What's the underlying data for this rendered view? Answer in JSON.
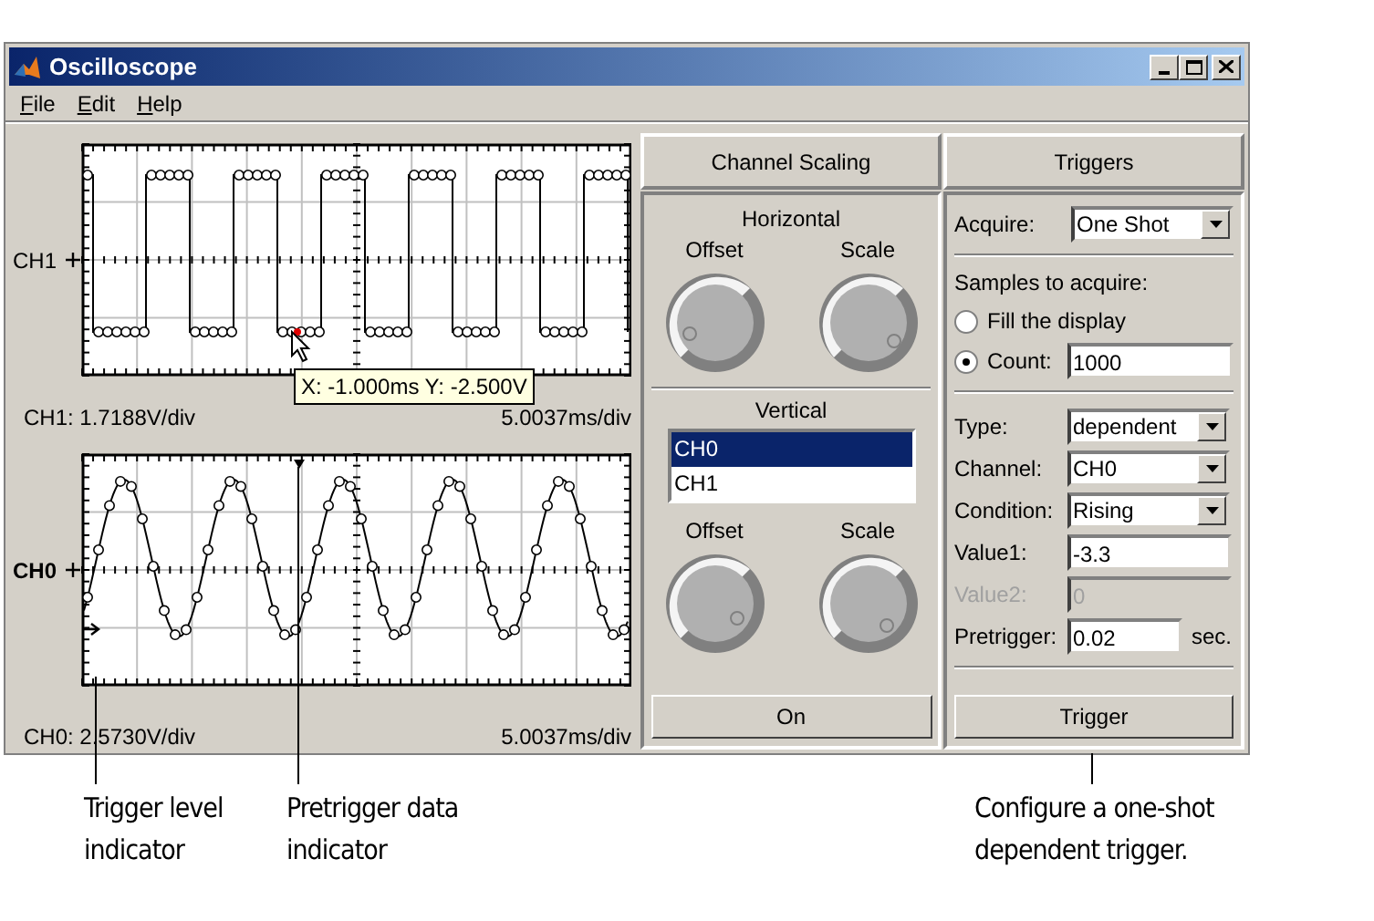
{
  "window": {
    "title": "Oscilloscope"
  },
  "menu": [
    {
      "label": "File"
    },
    {
      "label": "Edit"
    },
    {
      "label": "Help"
    }
  ],
  "plots": [
    {
      "channel": "CH1",
      "selected": false,
      "kind": "square",
      "scale": "CH1: 1.7188V/div",
      "time": "5.0037ms/div",
      "tooltip": "X: -1.000ms Y: -2.500V"
    },
    {
      "channel": "CH0",
      "selected": true,
      "kind": "sine",
      "scale": "CH0: 2.5730V/div",
      "time": "5.0037ms/div"
    }
  ],
  "channel_scaling": {
    "title": "Channel Scaling",
    "horizontal": {
      "title": "Horizontal",
      "knobs": [
        "Offset",
        "Scale"
      ]
    },
    "vertical": {
      "title": "Vertical",
      "channels": [
        {
          "label": "CH0",
          "selected": true
        },
        {
          "label": "CH1",
          "selected": false
        }
      ],
      "knobs": [
        "Offset",
        "Scale"
      ]
    },
    "button": "On"
  },
  "triggers": {
    "title": "Triggers",
    "acquire": {
      "label": "Acquire:",
      "value": "One Shot"
    },
    "samples_label": "Samples to acquire:",
    "options": [
      {
        "label": "Fill the display",
        "selected": false
      },
      {
        "label": "Count:",
        "selected": true,
        "value": "1000"
      }
    ],
    "fields": [
      {
        "kind": "dropdown",
        "label": "Type:",
        "value": "dependent",
        "disabled": false
      },
      {
        "kind": "dropdown",
        "label": "Channel:",
        "value": "CH0",
        "disabled": false
      },
      {
        "kind": "dropdown",
        "label": "Condition:",
        "value": "Rising",
        "disabled": false
      },
      {
        "kind": "input",
        "label": "Value1:",
        "value": "-3.3",
        "disabled": false
      },
      {
        "kind": "input",
        "label": "Value2:",
        "value": "0",
        "disabled": true
      },
      {
        "kind": "input",
        "label": "Pretrigger:",
        "value": "0.02",
        "unit": "sec.",
        "disabled": false
      }
    ],
    "button": "Trigger"
  },
  "callouts": [
    {
      "text": "Trigger level indicator"
    },
    {
      "text": "Pretrigger data indicator"
    },
    {
      "text": "Configure a one-shot dependent trigger."
    }
  ]
}
